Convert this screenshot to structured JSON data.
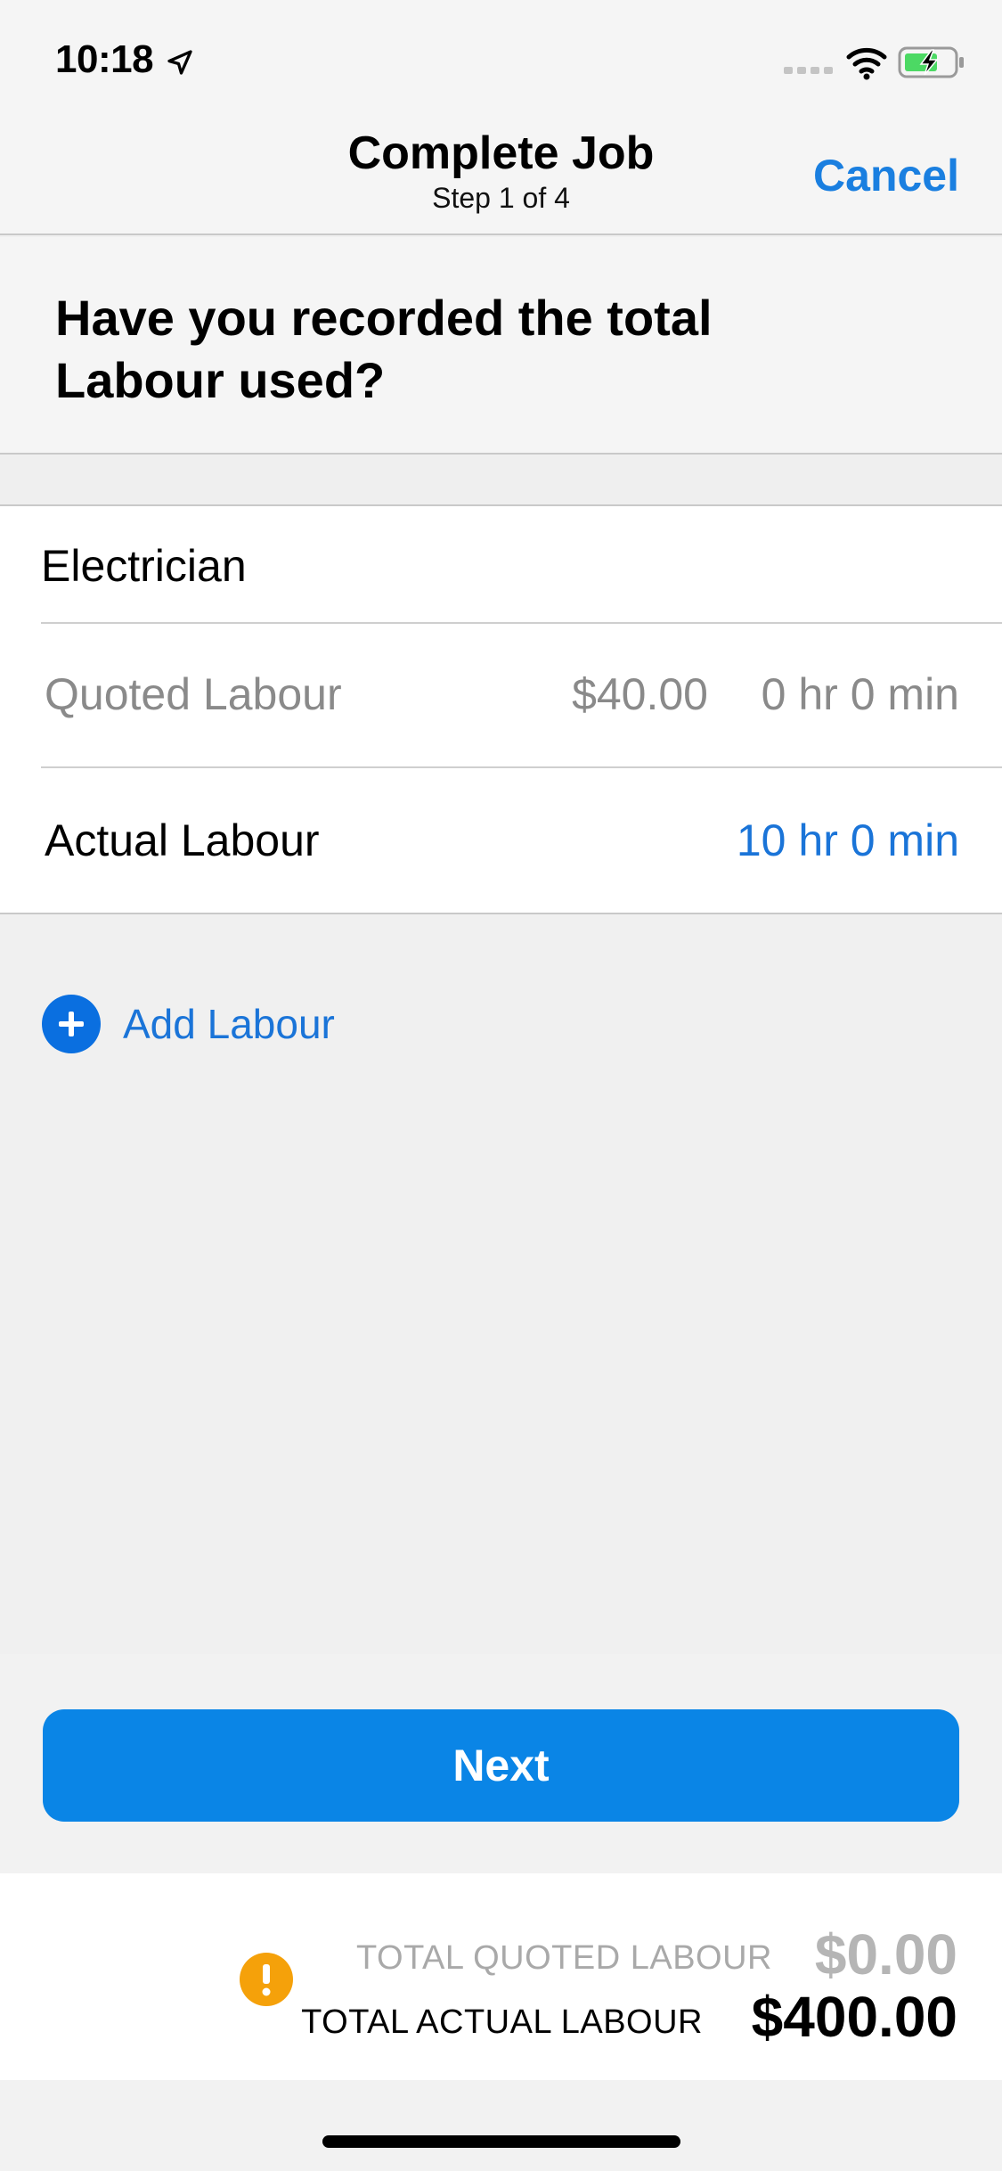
{
  "status_bar": {
    "time": "10:18",
    "icons": [
      "location-arrow-icon",
      "cellular-signal-icon",
      "wifi-icon",
      "battery-charging-icon"
    ],
    "battery_color": "#4cd964"
  },
  "nav": {
    "title": "Complete Job",
    "subtitle": "Step 1 of 4",
    "cancel_label": "Cancel"
  },
  "question": {
    "text": "Have you recorded the total Labour used?"
  },
  "labour": {
    "role": "Electrician",
    "quoted_label": "Quoted Labour",
    "quoted_price": "$40.00",
    "quoted_time": "0 hr 0 min",
    "actual_label": "Actual Labour",
    "actual_time": "10 hr 0 min"
  },
  "add_labour": {
    "label": "Add Labour",
    "icon": "plus-circle-icon"
  },
  "next_button": {
    "label": "Next"
  },
  "totals": {
    "quoted_label": "TOTAL QUOTED LABOUR",
    "quoted_value": "$0.00",
    "actual_label": "TOTAL ACTUAL LABOUR",
    "actual_value": "$400.00",
    "warning_icon": "warning-exclamation-icon"
  },
  "colors": {
    "accent": "#0a85e6",
    "link": "#1a74d8",
    "warning": "#f5a10a"
  }
}
